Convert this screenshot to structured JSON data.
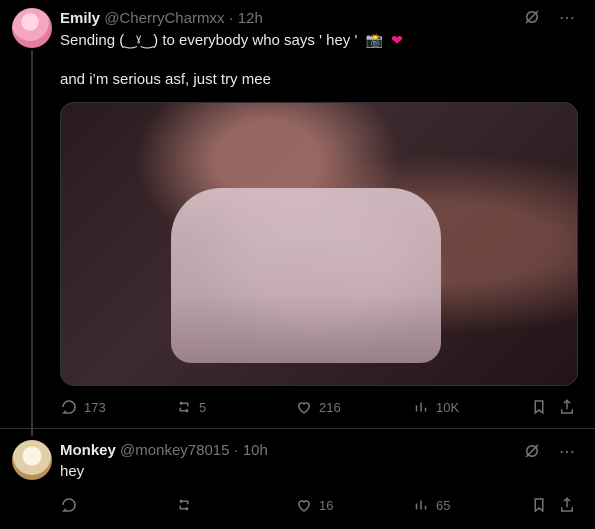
{
  "post1": {
    "user": {
      "name": "Emily",
      "handle": "@CherryCharmxx",
      "time": "12h"
    },
    "lines": [
      "Sending (‿ˠ‿) to everybody who says ' hey '",
      "and i’m serious asf, just try mee"
    ],
    "actions": {
      "replies": "173",
      "reposts": "5",
      "likes": "216",
      "views": "10K"
    }
  },
  "post2": {
    "user": {
      "name": "Monkey",
      "handle": "@monkey78015",
      "time": "10h"
    },
    "lines": [
      "hey"
    ],
    "actions": {
      "replies": "",
      "reposts": "",
      "likes": "16",
      "views": "65"
    }
  },
  "colors": {
    "background": "#000000",
    "text": "#e7e9ea",
    "muted": "#71767b",
    "divider": "#2f3336",
    "heart": "#f91880"
  }
}
